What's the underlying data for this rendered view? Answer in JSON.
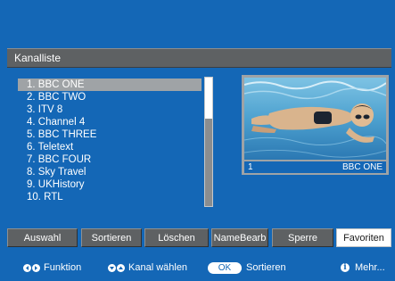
{
  "header": {
    "title": "Kanalliste"
  },
  "channels": [
    "1. BBC ONE",
    "2. BBC TWO",
    "3. ITV 8",
    "4. Channel 4",
    "5. BBC THREE",
    "6. Teletext",
    "7. BBC FOUR",
    "8. Sky Travel",
    "9. UKHistory",
    "10. RTL"
  ],
  "selected_index": 0,
  "scroll_position_fraction": 0.0,
  "preview": {
    "channel_number": "1",
    "channel_name": "BBC ONE"
  },
  "buttons": [
    {
      "label": "Auswahl",
      "active": false
    },
    {
      "label": "Sortieren",
      "active": false
    },
    {
      "label": "Löschen",
      "active": false
    },
    {
      "label": "NameBearb",
      "active": false
    },
    {
      "label": "Sperre",
      "active": false
    },
    {
      "label": "Favoriten",
      "active": true
    }
  ],
  "help": {
    "function_label": "Funktion",
    "channel_select_label": "Kanal wählen",
    "ok_label": "OK",
    "sort_label": "Sortieren",
    "info_icon_glyph": "i",
    "more_label": "Mehr..."
  },
  "icons": {
    "left_right": "left-right-arrows-icon",
    "up_down": "up-down-arrows-icon",
    "ok": "ok-button-icon",
    "info": "info-icon"
  },
  "colors": {
    "background": "#1467b6",
    "bar": "#5e6163",
    "selection": "#9fa3a6",
    "active_button": "#ffffff"
  }
}
